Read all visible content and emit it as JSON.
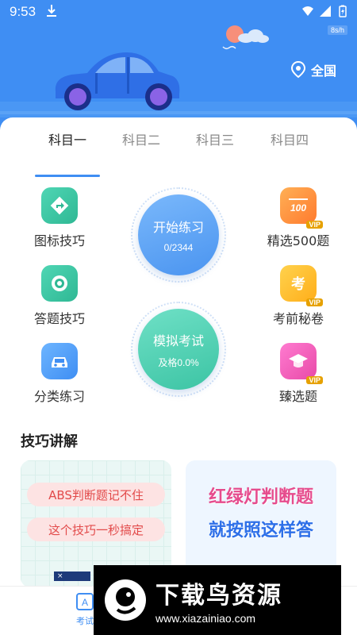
{
  "status_bar": {
    "time": "9:53",
    "speed": "8s/h"
  },
  "header": {
    "location_label": "全国"
  },
  "tabs": [
    {
      "label": "科目一",
      "active": true
    },
    {
      "label": "科目二",
      "active": false
    },
    {
      "label": "科目三",
      "active": false
    },
    {
      "label": "科目四",
      "active": false
    }
  ],
  "features_left": [
    {
      "label": "图标技巧",
      "icon": "traffic-sign-icon"
    },
    {
      "label": "答题技巧",
      "icon": "medal-icon"
    },
    {
      "label": "分类练习",
      "icon": "car-icon"
    }
  ],
  "features_right": [
    {
      "label": "精选500题",
      "icon": "score-100-icon",
      "badge": "VIP"
    },
    {
      "label": "考前秘卷",
      "icon": "exam-paper-icon",
      "badge": "VIP"
    },
    {
      "label": "臻选题",
      "icon": "graduation-cap-icon",
      "badge": "VIP"
    }
  ],
  "practice": {
    "title": "开始练习",
    "progress": "0/2344"
  },
  "exam": {
    "title": "模拟考试",
    "pass_rate": "及格0.0%"
  },
  "section": {
    "title": "技巧讲解"
  },
  "tip_left": {
    "line1": "ABS判断题记不住",
    "line2": "这个技巧一秒搞定"
  },
  "tip_right": {
    "line1": "红绿灯判断题",
    "line2": "就按照这样答"
  },
  "bottom_nav": {
    "item1": "考试"
  },
  "ad": {
    "close_label": "×"
  },
  "watermark": {
    "brand": "下载鸟资源",
    "url": "www.xiazainiao.com"
  },
  "colors": {
    "primary": "#3f8ef3",
    "vip": "#e6a100"
  }
}
